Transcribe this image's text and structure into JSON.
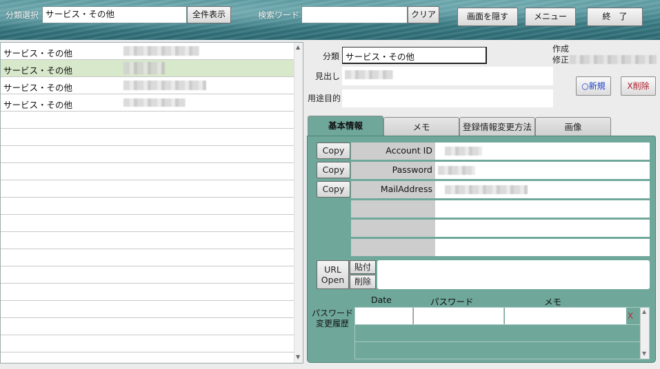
{
  "header": {
    "category_label": "分類選択",
    "category_value": "サービス・その他",
    "show_all_button": "全件表示",
    "search_label": "検索ワード",
    "search_value": "",
    "clear_button": "クリア",
    "hide_button": "画面を隠す",
    "menu_button": "メニュー",
    "exit_button": "終　了"
  },
  "list": {
    "rows": [
      {
        "category": "サービス・その他",
        "selected": false
      },
      {
        "category": "サービス・その他",
        "selected": true
      },
      {
        "category": "サービス・その他",
        "selected": false
      },
      {
        "category": "サービス・その他",
        "selected": false
      }
    ],
    "scroll_up": "▲",
    "scroll_down": "▼"
  },
  "detail": {
    "category_label": "分類",
    "category_value": "サービス・その他",
    "heading_label": "見出し",
    "purpose_label": "用途目的",
    "created_label": "作成",
    "modified_label": "修正",
    "new_button": "○新規",
    "delete_button": "X削除"
  },
  "tabs": [
    {
      "label": "基本情報",
      "active": true
    },
    {
      "label": "メモ",
      "active": false
    },
    {
      "label": "登録情報変更方法",
      "active": false
    },
    {
      "label": "画像",
      "active": false
    }
  ],
  "basic": {
    "copy_label": "Copy",
    "fields": [
      "Account ID",
      "Password",
      "MailAddress"
    ],
    "url_open": "URL Open",
    "paste_button": "貼付",
    "remove_button": "削除",
    "history_label": "パスワード 変更履歴",
    "history_columns": [
      "Date",
      "パスワード",
      "メモ"
    ],
    "history_delete": "X"
  }
}
